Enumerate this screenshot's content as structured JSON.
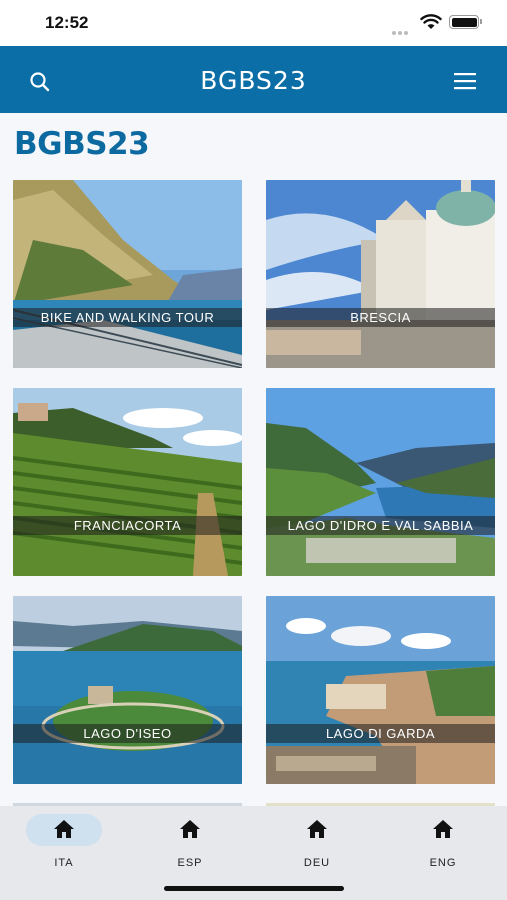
{
  "status": {
    "time": "12:52"
  },
  "header": {
    "title": "BGBS23"
  },
  "page": {
    "title": "BGBS23"
  },
  "cards": [
    {
      "label": "BIKE AND WALKING TOUR"
    },
    {
      "label": "BRESCIA"
    },
    {
      "label": "FRANCIACORTA"
    },
    {
      "label": "LAGO D'IDRO E VAL SABBIA"
    },
    {
      "label": "LAGO D'ISEO"
    },
    {
      "label": "LAGO DI GARDA"
    }
  ],
  "tabs": [
    {
      "label": "ITA",
      "active": true
    },
    {
      "label": "ESP"
    },
    {
      "label": "DEU"
    },
    {
      "label": "ENG"
    }
  ],
  "colors": {
    "header": "#0b6ea6",
    "title": "#0d6aa0",
    "tab_active": "#cfe0ee"
  },
  "icons": {
    "search": "search-icon",
    "menu": "hamburger-menu-icon",
    "tab": "home-icon"
  }
}
